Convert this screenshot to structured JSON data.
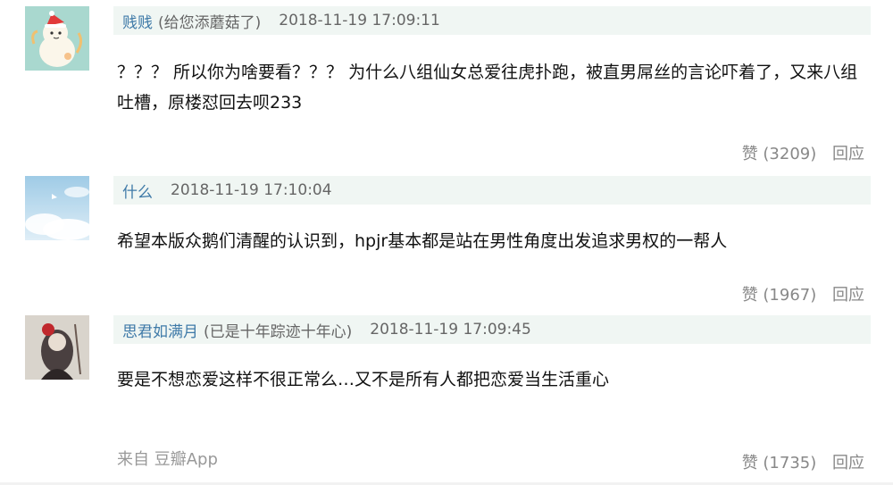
{
  "comments": [
    {
      "author": "贱贱",
      "note": "(给您添蘑菇了)",
      "time": "2018-11-19 17:09:11",
      "content": "？？？ 所以你为啥要看？？？ 为什么八组仙女总爱往虎扑跑，被直男屌丝的言论吓着了，又来八组吐槽，原楼怼回去呗233",
      "likes": "赞 (3209)",
      "reply": "回应"
    },
    {
      "author": "什么",
      "time": "2018-11-19 17:10:04",
      "content": "希望本版众鹅们清醒的认识到，hpjr基本都是站在男性角度出发追求男权的一帮人",
      "likes": "赞 (1967)",
      "reply": "回应"
    },
    {
      "author": "思君如满月",
      "note": "(已是十年踪迹十年心)",
      "time": "2018-11-19 17:09:45",
      "content": "要是不想恋爱这样不很正常么…又不是所有人都把恋爱当生活重心",
      "likes": "赞 (1735)",
      "reply": "回应"
    }
  ],
  "source": "来自 豆瓣App",
  "colors": {
    "author": "#3f7aa8",
    "header_bg": "#f0f6f3",
    "muted": "#888888"
  }
}
